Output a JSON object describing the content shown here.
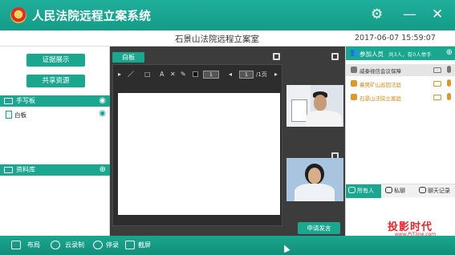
{
  "app": {
    "title": "人民法院远程立案系统"
  },
  "header": {
    "room_title": "石景山法院远程立案室",
    "datetime": "2017-06-07  15:59:07"
  },
  "left": {
    "btn_evidence": "证据展示",
    "btn_share": "共享资源",
    "handwriting_label": "手写板",
    "whiteboard_item": "白板",
    "library_label": "资料库"
  },
  "center": {
    "whiteboard_tab": "白板",
    "page_current": "1",
    "page_total": "/1页",
    "zoom": "1",
    "speak_button": "申请发言"
  },
  "participants": {
    "title": "参加人员",
    "summary": "共3人，有0人举手",
    "list": [
      {
        "name": "威泰视信会议保障",
        "selected": true
      },
      {
        "name": "襄樊矿山巡回法庭",
        "selected": false
      },
      {
        "name": "石景山法院立案庭",
        "selected": false
      }
    ]
  },
  "chat": {
    "tabs": [
      "所有人",
      "私聊",
      "聊天记录"
    ]
  },
  "bottom": {
    "items": [
      "布局",
      "云录制",
      "停录",
      "截屏"
    ]
  },
  "watermark": {
    "main": "投影时代",
    "sub": "www.PjTime.com"
  },
  "colors": {
    "accent": "#1aa68f",
    "title_bar": "#1fae9a",
    "warning": "#d99a2b"
  }
}
